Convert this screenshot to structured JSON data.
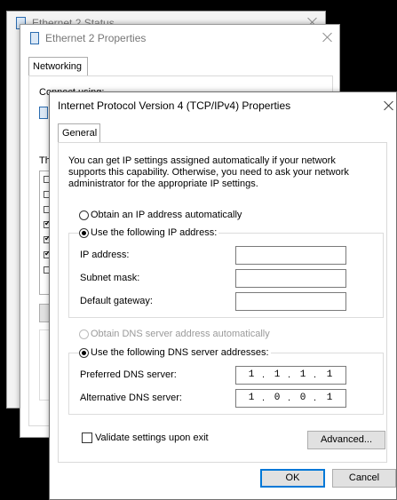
{
  "status_window": {
    "title": "Ethernet 2 Status"
  },
  "props_window": {
    "title": "Ethernet 2 Properties",
    "tab": "Networking",
    "connect_label": "Connect using:",
    "items_label": "Th"
  },
  "ipv4_dialog": {
    "title": "Internet Protocol Version 4 (TCP/IPv4) Properties",
    "tab": "General",
    "description": "You can get IP settings assigned automatically if your network supports this capability. Otherwise, you need to ask your network administrator for the appropriate IP settings.",
    "ip_auto_label": "Obtain an IP address automatically",
    "ip_manual_label": "Use the following IP address:",
    "ip_address_label": "IP address:",
    "subnet_label": "Subnet mask:",
    "gateway_label": "Default gateway:",
    "ip_address_value": "",
    "subnet_value": "",
    "gateway_value": "",
    "dns_auto_label": "Obtain DNS server address automatically",
    "dns_manual_label": "Use the following DNS server addresses:",
    "preferred_dns_label": "Preferred DNS server:",
    "alternate_dns_label": "Alternative DNS server:",
    "preferred_dns": [
      "1",
      "1",
      "1",
      "1"
    ],
    "alternate_dns": [
      "1",
      "0",
      "0",
      "1"
    ],
    "validate_label": "Validate settings upon exit",
    "validate_checked": false,
    "advanced_button": "Advanced...",
    "ok_button": "OK",
    "cancel_button": "Cancel",
    "ip_mode": "manual",
    "dns_mode": "manual"
  },
  "colors": {
    "accent": "#0078d7",
    "background": "#000000"
  },
  "icons": {
    "adapter": "network-adapter-icon",
    "close": "close-icon"
  }
}
